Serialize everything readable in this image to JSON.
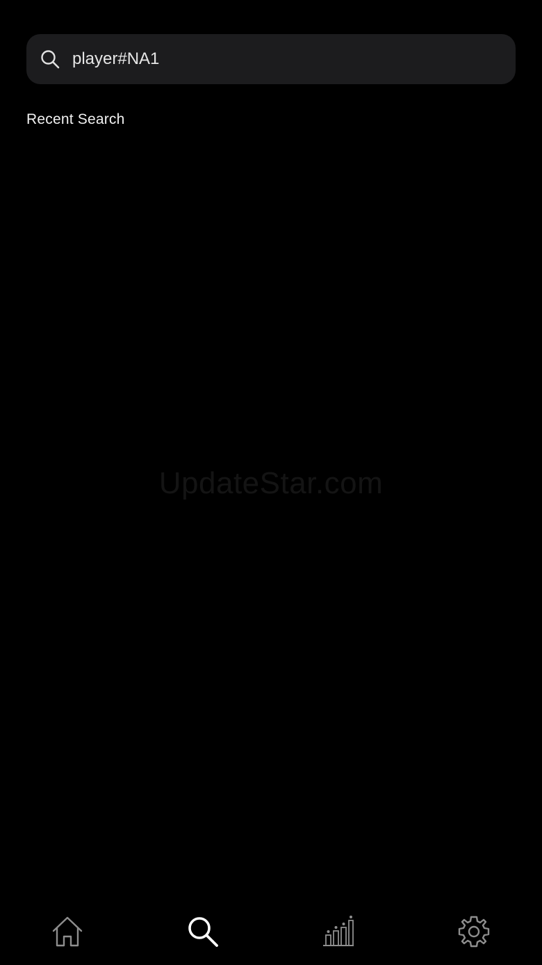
{
  "search": {
    "value": "player#NA1",
    "icon": "search-icon"
  },
  "recent": {
    "title": "Recent Search"
  },
  "watermark": {
    "text": "UpdateStar.com"
  },
  "tabs": [
    {
      "icon": "home-icon",
      "active": false
    },
    {
      "icon": "search-icon",
      "active": true
    },
    {
      "icon": "leaderboard-icon",
      "active": false
    },
    {
      "icon": "gear-icon",
      "active": false
    }
  ],
  "colors": {
    "background": "#000000",
    "search_bg": "#1c1c1e",
    "tab_active": "#ffffff",
    "tab_inactive": "#8e8e8e"
  }
}
